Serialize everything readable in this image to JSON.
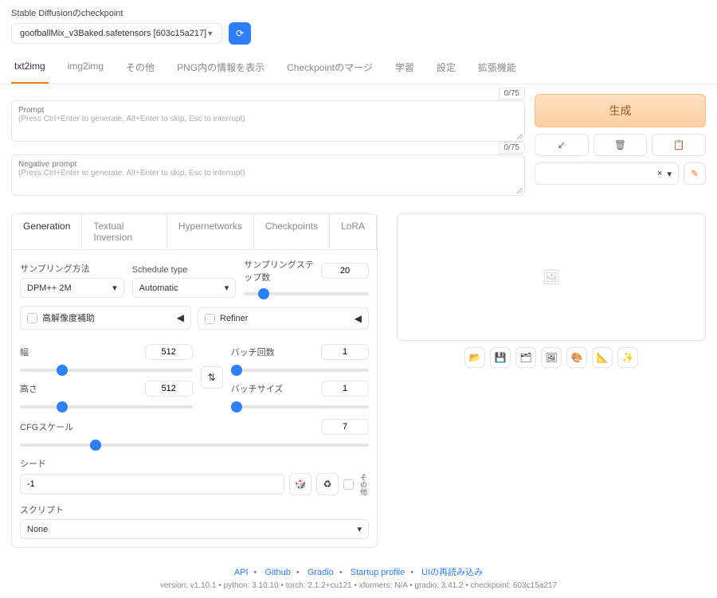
{
  "checkpoint": {
    "label": "Stable Diffusionのcheckpoint",
    "value": "goofballMix_v3Baked.safetensors [603c15a217]"
  },
  "tabs": [
    "txt2img",
    "img2img",
    "その他",
    "PNG内の情報を表示",
    "Checkpointのマージ",
    "学習",
    "設定",
    "拡張機能"
  ],
  "prompt": {
    "label": "Prompt",
    "hint": "(Press Ctrl+Enter to generate, Alt+Enter to skip, Esc to interrupt)",
    "token_count": "0/75"
  },
  "neg_prompt": {
    "label": "Negative prompt",
    "hint": "(Press Ctrl+Enter to generate, Alt+Enter to skip, Esc to interrupt)",
    "token_count": "0/75"
  },
  "generate_label": "生成",
  "style_clear": "×",
  "subtabs": [
    "Generation",
    "Textual Inversion",
    "Hypernetworks",
    "Checkpoints",
    "LoRA"
  ],
  "sampling": {
    "method_label": "サンプリング方法",
    "method_value": "DPM++ 2M",
    "schedule_label": "Schedule type",
    "schedule_value": "Automatic",
    "steps_label": "サンプリングステップ数",
    "steps_value": "20"
  },
  "collapse": {
    "hires": "高解像度補助",
    "refiner": "Refiner"
  },
  "dims": {
    "width_label": "幅",
    "width_value": "512",
    "height_label": "高さ",
    "height_value": "512",
    "batch_count_label": "バッチ回数",
    "batch_count_value": "1",
    "batch_size_label": "バッチサイズ",
    "batch_size_value": "1"
  },
  "cfg": {
    "label": "CFGスケール",
    "value": "7"
  },
  "seed": {
    "label": "シード",
    "value": "-1",
    "extra_label": "その他"
  },
  "script": {
    "label": "スクリプト",
    "value": "None"
  },
  "action_icons": [
    "📂",
    "💾",
    "🗂",
    "🖼",
    "🎨",
    "📐",
    "✨"
  ],
  "footer": {
    "links": [
      "API",
      "Github",
      "Gradio",
      "Startup profile",
      "UIの再読み込み"
    ],
    "version": "version: v1.10.1  •  python: 3.10.10  •  torch: 2.1.2+cu121  •  xformers: N/A  •  gradio: 3.41.2  •  checkpoint: 603c15a217"
  }
}
